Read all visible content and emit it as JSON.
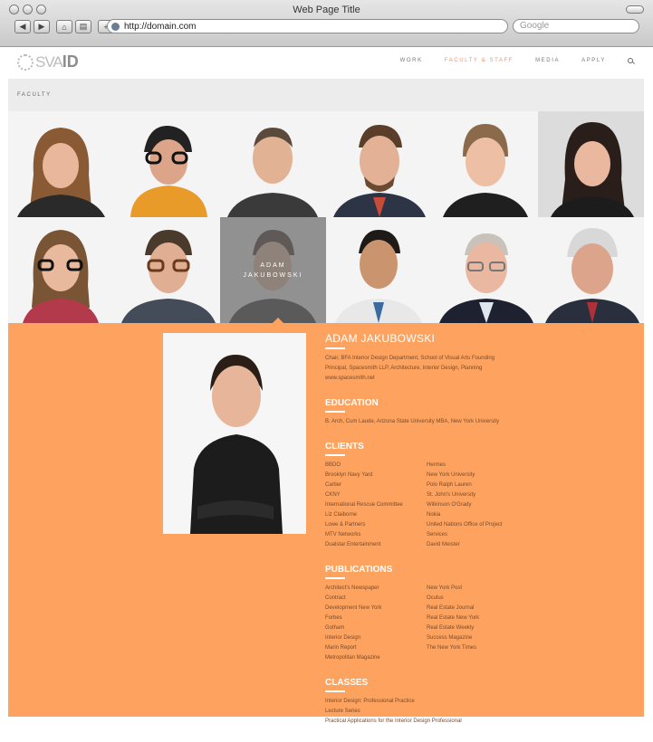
{
  "browser": {
    "window_title": "Web Page Title",
    "url": "http://domain.com",
    "search_placeholder": "Google"
  },
  "site": {
    "logo_sva": "SVA",
    "logo_id": "ID",
    "nav": [
      "WORK",
      "FACULTY & STAFF",
      "MEDIA",
      "APPLY"
    ],
    "active_nav": "FACULTY & STAFF",
    "accent_color": "#f0946a"
  },
  "section": {
    "label": "FACULTY"
  },
  "grid": {
    "selected_name": "ADAM JAKUBOWSKI"
  },
  "detail": {
    "panel_color": "#fda35f",
    "name": "ADAM JAKUBOWSKI",
    "bio": "Chair, BFA Interior Design Department, School of Visual Arts Founding Principal, Spacesmith LLP, Architecture, Interior Design, Planning www.spacesmith.net",
    "education_heading": "EDUCATION",
    "education": "B. Arch, Cum Laude, Arizona State University MBA, New York University",
    "clients_heading": "CLIENTS",
    "clients_left": [
      "BBDO",
      "Brooklyn Navy Yard",
      "Cartier",
      "CKNY",
      "International Rescue Committee",
      "Liz Claiborne",
      "Lowe & Partners",
      "MTV Networks",
      "Dualstar Entertainment"
    ],
    "clients_right": [
      "Hermes",
      "New York University",
      "Polo Ralph Lauren",
      "St. John's University",
      "Wilkinson O'Grady",
      "Nokia",
      "United Nations Office of Project",
      "Services",
      "David Meister"
    ],
    "publications_heading": "PUBLICATIONS",
    "publications_left": [
      "Architect's Newspaper",
      "Contract",
      "Development New York",
      "Forbes",
      "Gotham",
      "Interior Design",
      "Marin Report",
      "Metropolitan Magazine"
    ],
    "publications_right": [
      "New York Post",
      "Oculus",
      "Real Estate Journal",
      "Real Estate New York",
      "Real Estate Weekly",
      "Success Magazine",
      "The New York Times"
    ],
    "classes_heading": "CLASSES",
    "classes": [
      "Interior Design: Professional Practice",
      "Lecture Series",
      "Practical Applications for the Interior Design Professional"
    ]
  }
}
